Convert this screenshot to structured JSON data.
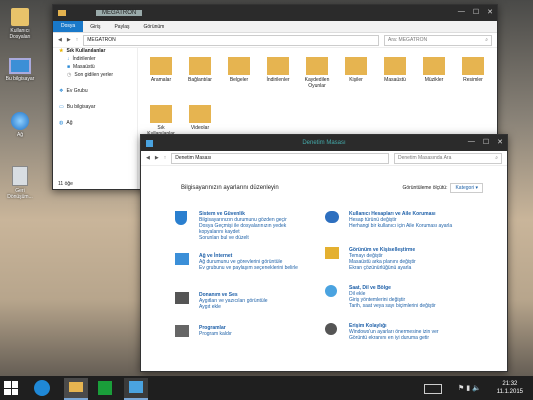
{
  "desktop": {
    "icons": [
      {
        "label": "Kullanıcı Dosyaları"
      },
      {
        "label": "Bu bilgisayar"
      },
      {
        "label": "Ağ"
      },
      {
        "label": "Geri Dönüşüm..."
      }
    ]
  },
  "explorer": {
    "title": "MEGATRON",
    "tabs": [
      "Dosya",
      "Giriş",
      "Paylaş",
      "Görünüm"
    ],
    "path": "MEGATRON",
    "search_placeholder": "Ara: MEGATRON",
    "nav": [
      "Sık Kullanılanlar",
      "İndirilenler",
      "Masaüstü",
      "Son gidilen yerler",
      "Ev Grubu",
      "Bu bilgisayar",
      "Ağ"
    ],
    "status": "11 öğe",
    "folders": [
      "Aramalar",
      "Bağlantılar",
      "Belgeler",
      "İndirilenler",
      "Kaydedilen Oyunlar",
      "Kişiler",
      "Masaüstü",
      "Müzikler",
      "Resimler",
      "Sık Kullanılanlar",
      "Videolar"
    ]
  },
  "control_panel": {
    "title": "Denetim Masası",
    "path": "Denetim Masası",
    "search_placeholder": "Denetim Masasında Ara",
    "heading": "Bilgisayarınızın ayarlarını düzenleyin",
    "view_label": "Görüntüleme ölçütü:",
    "view_value": "Kategori",
    "categories": [
      {
        "title": "Sistem ve Güvenlik",
        "links": [
          "Bilgisayarınızın durumunu gözden geçir",
          "Dosya Geçmişi ile dosyalarınızın yedek kopyalarını kaydet",
          "Sorunları bul ve düzelt"
        ]
      },
      {
        "title": "Ağ ve İnternet",
        "links": [
          "Ağ durumunu ve görevlerini görüntüle",
          "Ev grubunu ve paylaşım seçeneklerini belirle"
        ]
      },
      {
        "title": "Donanım ve Ses",
        "links": [
          "Aygıtları ve yazıcıları görüntüle",
          "Aygıt ekle"
        ]
      },
      {
        "title": "Programlar",
        "links": [
          "Program kaldır"
        ]
      },
      {
        "title": "Kullanıcı Hesapları ve Aile Koruması",
        "links": [
          "Hesap türünü değiştir",
          "Herhangi bir kullanıcı için Aile Koruması ayarla"
        ]
      },
      {
        "title": "Görünüm ve Kişiselleştirme",
        "links": [
          "Temayı değiştir",
          "Masaüstü arka planını değiştir",
          "Ekran çözünürlüğünü ayarla"
        ]
      },
      {
        "title": "Saat, Dil ve Bölge",
        "links": [
          "Dil ekle",
          "Giriş yöntemlerini değiştir",
          "Tarih, saat veya sayı biçimlerini değiştir"
        ]
      },
      {
        "title": "Erişim Kolaylığı",
        "links": [
          "Windows'un ayarları önermesine izin ver",
          "Görüntü ekranını en iyi duruma getir"
        ]
      }
    ]
  },
  "taskbar": {
    "time": "21:32",
    "date": "11.1.2015"
  }
}
